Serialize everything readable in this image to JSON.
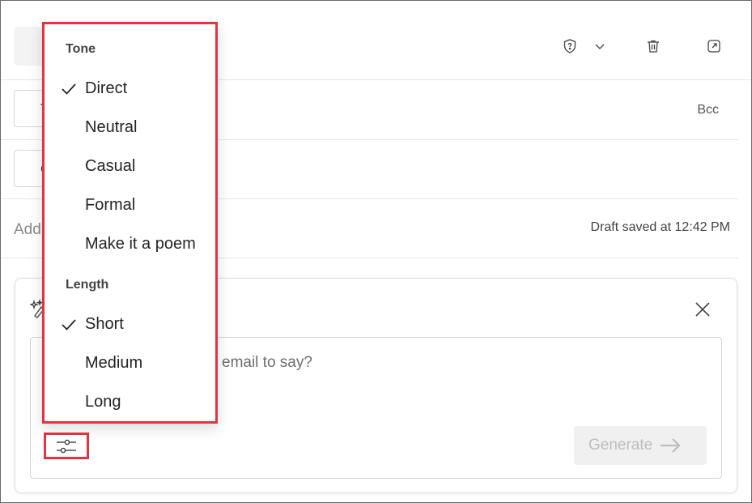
{
  "toolbar": {
    "icons": [
      "sensitivity-icon",
      "chevron-down-icon",
      "delete-icon",
      "popout-icon"
    ]
  },
  "fields": {
    "to_partial": "T",
    "cc_partial": "C",
    "bcc_label": "Bcc",
    "subject_partial": "Add",
    "draft_status": "Draft saved at 12:42 PM"
  },
  "copilot": {
    "prompt_placeholder_partial": "email to say?",
    "generate_label": "Generate"
  },
  "menu": {
    "tone_header": "Tone",
    "tone_items": [
      {
        "label": "Direct",
        "checked": true
      },
      {
        "label": "Neutral",
        "checked": false
      },
      {
        "label": "Casual",
        "checked": false
      },
      {
        "label": "Formal",
        "checked": false
      },
      {
        "label": "Make it a poem",
        "checked": false
      }
    ],
    "length_header": "Length",
    "length_items": [
      {
        "label": "Short",
        "checked": true
      },
      {
        "label": "Medium",
        "checked": false
      },
      {
        "label": "Long",
        "checked": false
      }
    ]
  },
  "colors": {
    "highlight": "#e5343f",
    "disabled_text": "#bdbdbd"
  }
}
